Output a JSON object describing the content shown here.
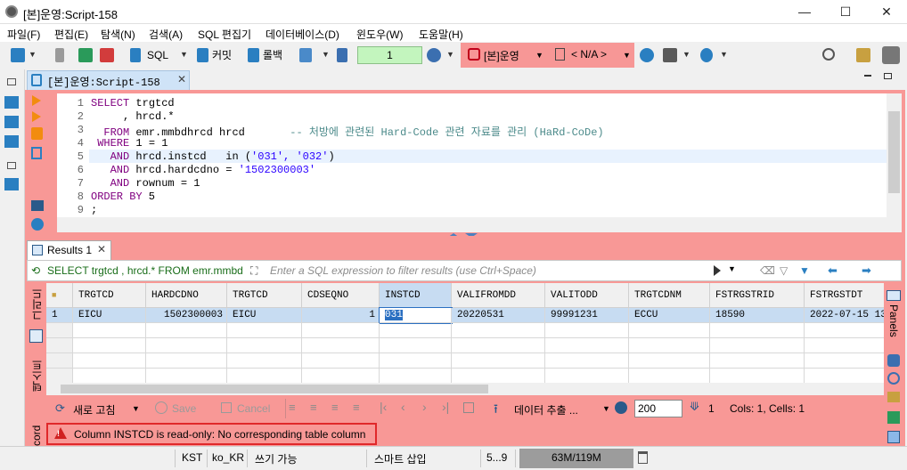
{
  "window": {
    "title": "[본]운영:Script-158"
  },
  "menu": [
    "파일(F)",
    "편집(E)",
    "탐색(N)",
    "검색(A)",
    "SQL 편집기",
    "데이터베이스(D)",
    "윈도우(W)",
    "도움말(H)"
  ],
  "toolbar": {
    "sql_label": "SQL",
    "commit_label": "커밋",
    "rollback_label": "롤백",
    "transaction_count": "1",
    "connection_label": "[본]운영",
    "schema_label": "< N/A >"
  },
  "editor_tab": {
    "label": "[본]운영:Script-158"
  },
  "editor": {
    "line_numbers": [
      "1",
      "2",
      "3",
      "4",
      "5",
      "6",
      "7",
      "8",
      "9"
    ],
    "lines": [
      {
        "pre": "",
        "kw": "SELECT",
        "rest": " trgtcd"
      },
      {
        "pre": "     , hrcd.*",
        "kw": "",
        "rest": ""
      },
      {
        "pre": "  ",
        "kw": "FROM",
        "rest": " emr.mmbdhrcd hrcd",
        "comment": "       -- 처방에 관련된 Hard-Code 관련 자료를 관리 (HaRd-CoDe)"
      },
      {
        "pre": " ",
        "kw": "WHERE",
        "rest": " 1 = 1"
      },
      {
        "pre": "   ",
        "kw": "AND",
        "rest": " hrcd.instcd   in (",
        "str": "'031', '032'",
        "tail": ")"
      },
      {
        "pre": "   ",
        "kw": "AND",
        "rest": " hrcd.hardcdno = ",
        "str": "'1502300003'",
        "tail": ""
      },
      {
        "pre": "   ",
        "kw": "AND",
        "rest": " rownum = 1"
      },
      {
        "pre": "",
        "kw": "ORDER BY",
        "rest": " 5"
      },
      {
        "pre": ";",
        "kw": "",
        "rest": ""
      }
    ]
  },
  "results": {
    "tab_label": "Results 1",
    "filter_query": "SELECT trgtcd , hrcd.* FROM emr.mmbd",
    "filter_placeholder": "Enter a SQL expression to filter results (use Ctrl+Space)",
    "side_labels": {
      "grid": "그리드",
      "text": "텍스트",
      "record": "cord"
    },
    "columns": [
      "TRGTCD",
      "HARDCDNO",
      "TRGTCD",
      "CDSEQNO",
      "INSTCD",
      "VALIFROMDD",
      "VALITODD",
      "TRGTCDNM",
      "FSTRGSTRID",
      "FSTRGSTDT"
    ],
    "rows": [
      {
        "num": "1",
        "cells": [
          "EICU",
          "1502300003",
          "EICU",
          "1",
          "031",
          "20220531",
          "99991231",
          "ECCU",
          "18590",
          "2022-07-15 13:"
        ]
      }
    ],
    "panels_label": "Panels"
  },
  "bottom": {
    "refresh_label": "새로 고침",
    "save_label": "Save",
    "cancel_label": "Cancel",
    "export_label": "데이터 추출 ...",
    "fetch_size": "200",
    "row_count": "1",
    "selection_info": "Cols: 1, Cells: 1"
  },
  "error": {
    "message": "Column INSTCD is read-only: No corresponding table column"
  },
  "status": {
    "timezone": "KST",
    "locale": "ko_KR",
    "mode": "쓰기 가능",
    "insert_mode": "스마트 삽입",
    "position": "5...9",
    "memory": "63M/119M"
  },
  "colors": {
    "highlight": "#f89896",
    "transaction": "#c3f5be",
    "error_border": "#e0282a",
    "selection": "#c7dcf2"
  }
}
